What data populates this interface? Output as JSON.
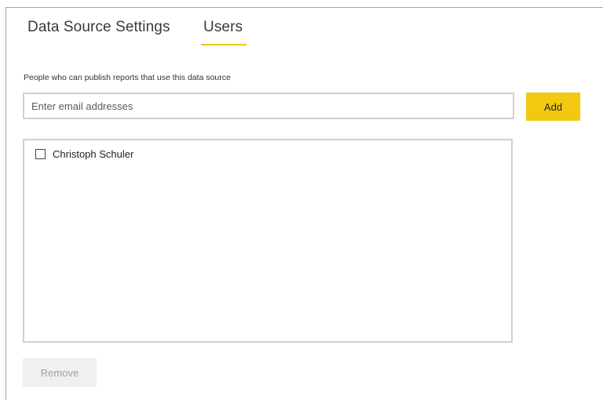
{
  "tabs": {
    "settings_label": "Data Source Settings",
    "users_label": "Users",
    "active": "Users"
  },
  "users_panel": {
    "description": "People who can publish reports that use this data source",
    "email_input": {
      "placeholder": "Enter email addresses",
      "value": ""
    },
    "add_label": "Add",
    "users": [
      {
        "name": "Christoph Schuler",
        "checked": false
      }
    ],
    "remove_label": "Remove"
  },
  "colors": {
    "accent": "#f2c811",
    "border": "#d0d0d0",
    "disabled_button_bg": "#f0f0f0",
    "disabled_button_text": "#a0a0a0"
  }
}
